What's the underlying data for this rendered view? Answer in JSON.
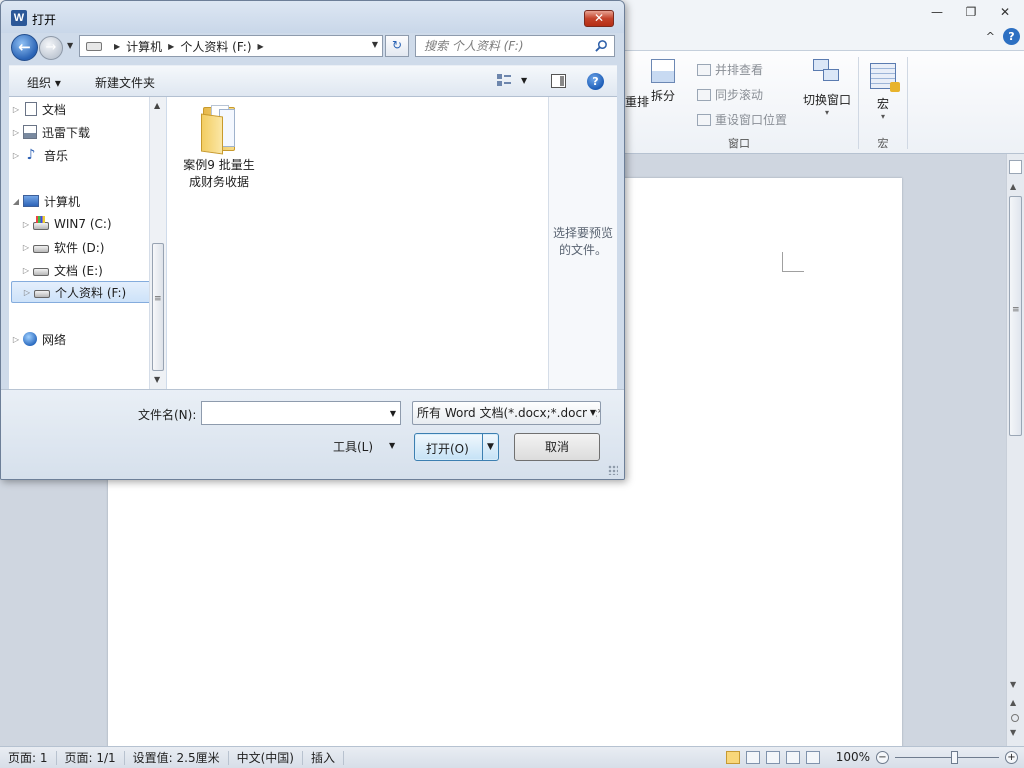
{
  "word": {
    "window_controls": [
      "—",
      "❐",
      "✕"
    ],
    "ribbon_tabbar": {
      "collapse": "^",
      "help": "?"
    },
    "ribbon": {
      "arrange_partial": "重排",
      "split": "拆分",
      "side_by_side": "并排查看",
      "sync_scroll": "同步滚动",
      "reset_position": "重设窗口位置",
      "switch_window": "切换窗口",
      "macro": "宏",
      "group_window": "窗口",
      "group_macro": "宏"
    },
    "statusbar": {
      "page": "页面: 1",
      "pages": "页面: 1/1",
      "setting": "设置值: 2.5厘米",
      "language": "中文(中国)",
      "mode": "插入",
      "zoom": "100%"
    }
  },
  "dialog": {
    "title": "打开",
    "app_icon_letter": "W",
    "close": "✕",
    "address": {
      "crumbs": [
        "计算机",
        "个人资料 (F:)"
      ]
    },
    "search": {
      "placeholder": "搜索 个人资料 (F:)"
    },
    "toolbar": {
      "organize": "组织 ▾",
      "new_folder": "新建文件夹",
      "help": "?"
    },
    "nav": [
      {
        "label": "文档",
        "icon": "documents-icon"
      },
      {
        "label": "迅雷下载",
        "icon": "downloads-icon"
      },
      {
        "label": "音乐",
        "icon": "music-icon"
      },
      {
        "label": "计算机",
        "icon": "computer-icon"
      },
      {
        "label": "WIN7 (C:)",
        "icon": "system-drive-icon"
      },
      {
        "label": "软件 (D:)",
        "icon": "drive-icon"
      },
      {
        "label": "文档 (E:)",
        "icon": "drive-icon"
      },
      {
        "label": "个人资料 (F:)",
        "icon": "drive-icon",
        "selected": true
      },
      {
        "label": "网络",
        "icon": "network-icon"
      }
    ],
    "files": [
      {
        "name": "案例9 批量生成财务收据"
      }
    ],
    "preview_text": "选择要预览的文件。",
    "bottom": {
      "filename_label": "文件名(N):",
      "filename_value": "",
      "filetype": "所有 Word 文档(*.docx;*.docm;*.dotx;*.dotm;*.doc;*.dot;*.htm;*.html;*.rtf;*.mht;*.mhtml;*.xml)",
      "tools": "工具(L)",
      "open": "打开(O)",
      "cancel": "取消"
    }
  }
}
